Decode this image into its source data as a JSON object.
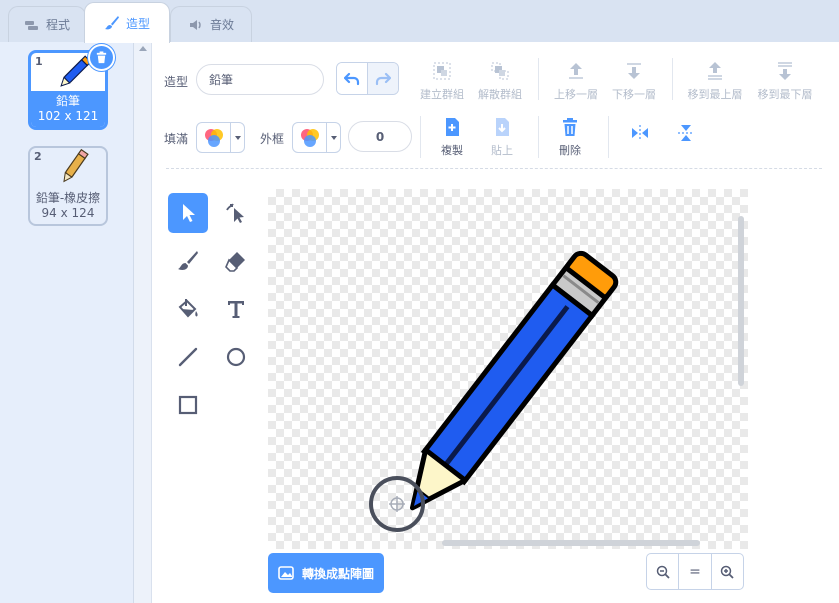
{
  "tabs": {
    "code": "程式",
    "costumes": "造型",
    "sounds": "音效"
  },
  "costumes": [
    {
      "number": "1",
      "name": "鉛筆",
      "size": "102 x 121",
      "selected": true
    },
    {
      "number": "2",
      "name": "鉛筆-橡皮擦",
      "size": "94 x 124",
      "selected": false
    }
  ],
  "toolbar": {
    "costume_label": "造型",
    "costume_name": "鉛筆",
    "group": "建立群組",
    "ungroup": "解散群組",
    "forward": "上移一層",
    "backward": "下移一層",
    "front": "移到最上層",
    "back": "移到最下層",
    "fill_label": "填滿",
    "outline_label": "外框",
    "outline_width": "0",
    "copy": "複製",
    "paste": "貼上",
    "delete": "刪除"
  },
  "canvas": {
    "convert_button": "轉換成點陣圖"
  },
  "zoom": {
    "out": "−",
    "reset": "=",
    "in": "+"
  },
  "colors": {
    "accent": "#4c97ff",
    "pencil_body": "#1f5cf0",
    "pencil_eraser": "#ff9c0a",
    "pencil_tip": "#fdf6c9"
  }
}
